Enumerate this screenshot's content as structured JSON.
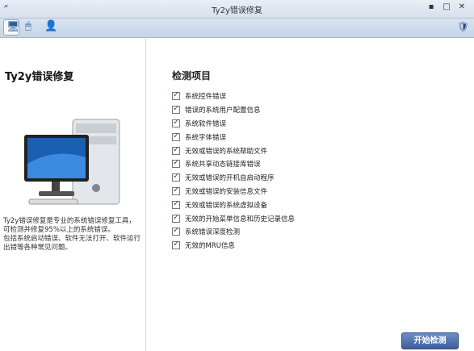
{
  "window": {
    "title": "Ty2y错误修复",
    "app_icon": "app-icon",
    "minimize": "▪",
    "maximize": "□",
    "close": "✕"
  },
  "toolbar": {
    "icons": [
      "monitor-icon",
      "mouse-icon",
      "person-icon"
    ],
    "tray_icon": "shield-icon"
  },
  "left": {
    "heading": "Ty2y错误修复",
    "description": "Ty2y错误修复是专业的系统错误修复工具，可检测并修复95%以上的系统错误。\n包括系统启动错误、软件无法打开、软件运行出错等各种常见问题。"
  },
  "right": {
    "heading": "检测项目",
    "items": [
      {
        "label": "系统控件错误",
        "checked": true
      },
      {
        "label": "错误的系统用户配置信息",
        "checked": true
      },
      {
        "label": "系统软件错误",
        "checked": true
      },
      {
        "label": "系统字体错误",
        "checked": true
      },
      {
        "label": "无效或错误的系统帮助文件",
        "checked": true
      },
      {
        "label": "系统共享动态链接库错误",
        "checked": true
      },
      {
        "label": "无效或错误的开机自启动程序",
        "checked": true
      },
      {
        "label": "无效或错误的安装信息文件",
        "checked": true
      },
      {
        "label": "无效或错误的系统虚拟设备",
        "checked": true
      },
      {
        "label": "无效的开始菜单信息和历史记录信息",
        "checked": true
      },
      {
        "label": "系统错误深度检测",
        "checked": true
      },
      {
        "label": "无效的MRU信息",
        "checked": true
      }
    ]
  },
  "buttons": {
    "start": "开始检测"
  }
}
